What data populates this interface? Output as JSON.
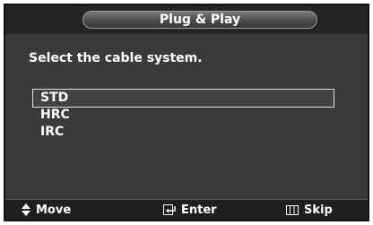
{
  "title": "Plug & Play",
  "prompt": "Select the cable system.",
  "options": [
    {
      "label": "STD",
      "selected": true
    },
    {
      "label": "HRC",
      "selected": false
    },
    {
      "label": "IRC",
      "selected": false
    }
  ],
  "footer": {
    "move": {
      "label": "Move",
      "icon": "up-down-arrow-icon"
    },
    "enter": {
      "label": "Enter",
      "icon": "enter-icon"
    },
    "skip": {
      "label": "Skip",
      "icon": "menu-icon"
    }
  },
  "colors": {
    "panel": "#3a3a3a",
    "footer": "#1f1f1f",
    "text": "#ffffff"
  }
}
